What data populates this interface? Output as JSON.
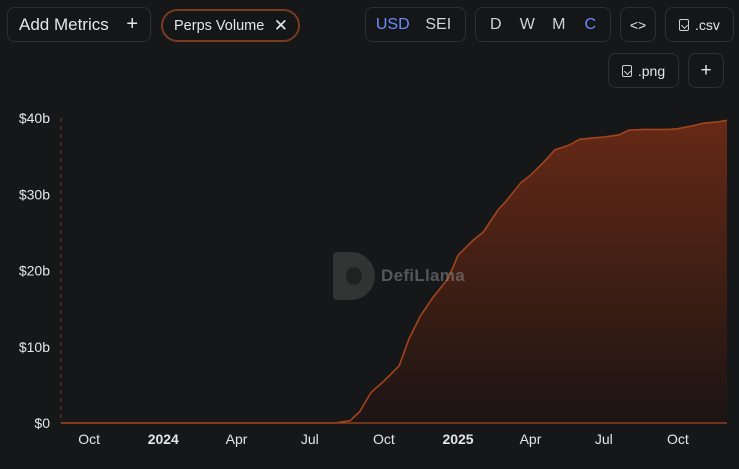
{
  "toolbar": {
    "add_metrics_label": "Add Metrics",
    "add_metrics_icon": "plus-icon",
    "metric_tag_label": "Perps Volume",
    "metric_tag_remove_icon": "close-icon",
    "currency_options": [
      "USD",
      "SEI"
    ],
    "currency_selected": "USD",
    "period_options": [
      "D",
      "W",
      "M",
      "C"
    ],
    "period_selected": "C",
    "embed_label": "<>",
    "csv_label": ".csv",
    "png_label": ".png",
    "add_label": "+"
  },
  "watermark": {
    "text": "DefiLlama"
  },
  "colors": {
    "line": "#a2441e",
    "active": "#6c8cff",
    "tag_border": "#7a3b22"
  },
  "chart_data": {
    "type": "area",
    "title": "",
    "xlabel": "",
    "ylabel": "",
    "ylim": [
      0,
      40
    ],
    "y_unit": "b",
    "y_ticks": [
      "$0",
      "$10b",
      "$20b",
      "$30b",
      "$40b"
    ],
    "x_ticks": [
      {
        "label": "Oct",
        "bold": false
      },
      {
        "label": "2024",
        "bold": true
      },
      {
        "label": "Apr",
        "bold": false
      },
      {
        "label": "Jul",
        "bold": false
      },
      {
        "label": "Oct",
        "bold": false
      },
      {
        "label": "2025",
        "bold": true
      },
      {
        "label": "Apr",
        "bold": false
      },
      {
        "label": "Jul",
        "bold": false
      },
      {
        "label": "Oct",
        "bold": false
      }
    ],
    "series": [
      {
        "x": [
          "2023-08-27",
          "2024-08-01",
          "2024-08-20",
          "2024-09-01",
          "2024-09-15",
          "2024-10-01",
          "2024-10-20",
          "2024-11-01",
          "2024-11-15",
          "2024-12-01",
          "2024-12-20",
          "2025-01-01",
          "2025-01-20",
          "2025-02-01",
          "2025-02-20",
          "2025-03-01",
          "2025-03-20",
          "2025-04-01",
          "2025-04-20",
          "2025-05-01",
          "2025-05-20",
          "2025-06-01",
          "2025-06-20",
          "2025-07-01",
          "2025-07-20",
          "2025-08-01",
          "2025-08-20",
          "2025-09-01",
          "2025-09-20",
          "2025-10-01",
          "2025-10-20",
          "2025-11-01",
          "2025-11-20",
          "2025-12-01"
        ],
        "values": [
          0,
          0,
          0.3,
          1.5,
          4,
          5.5,
          7.5,
          11,
          14,
          16.5,
          19,
          22,
          24,
          25,
          28,
          29,
          31.5,
          32.5,
          34.5,
          35.8,
          36.5,
          37.2,
          37.4,
          37.5,
          37.8,
          38.4,
          38.5,
          38.5,
          38.5,
          38.6,
          39.0,
          39.3,
          39.5,
          39.7
        ]
      }
    ]
  }
}
